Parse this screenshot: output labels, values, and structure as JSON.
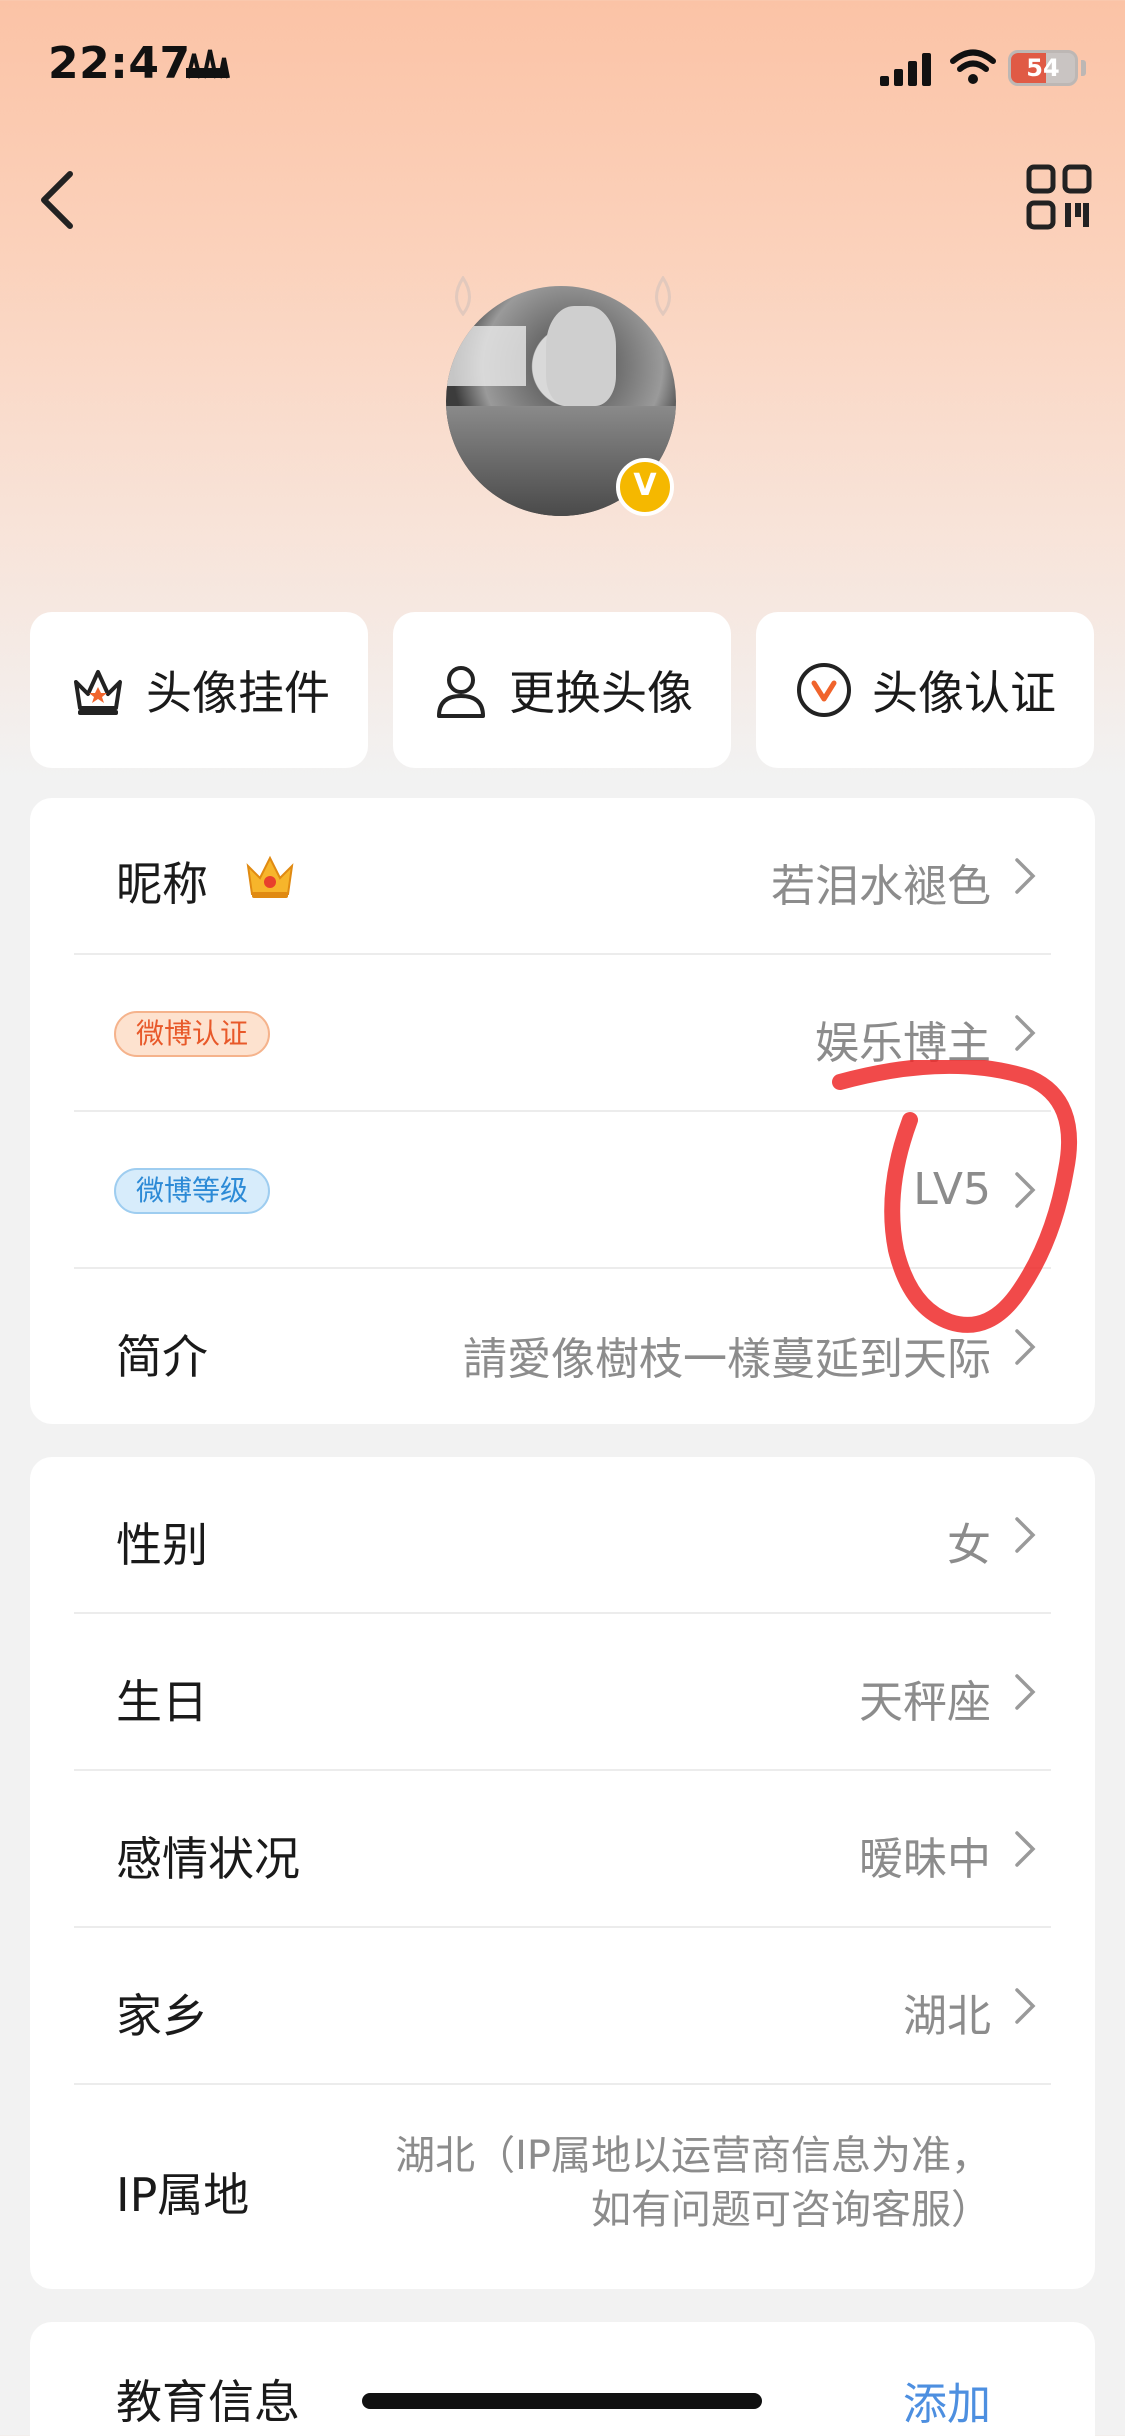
{
  "status_bar": {
    "time": "22:47",
    "battery": "54",
    "battery_fraction": 0.54
  },
  "actions": [
    {
      "label": "头像挂件",
      "icon": "pendant-icon"
    },
    {
      "label": "更换头像",
      "icon": "user-icon"
    },
    {
      "label": "头像认证",
      "icon": "verify-icon"
    }
  ],
  "profile": {
    "nickname_label": "昵称",
    "nickname_value": "若泪水褪色",
    "verify_tag": "微博认证",
    "verify_value": "娱乐博主",
    "level_tag": "微博等级",
    "level_value": "LV5",
    "bio_label": "简介",
    "bio_value": "請愛像樹枝一樣蔓延到天际"
  },
  "details": {
    "gender_label": "性别",
    "gender_value": "女",
    "birthday_label": "生日",
    "birthday_value": "天秤座",
    "relationship_label": "感情状况",
    "relationship_value": "暧昧中",
    "hometown_label": "家乡",
    "hometown_value": "湖北",
    "ip_label": "IP属地",
    "ip_value_line1": "湖北（IP属地以运营商信息为准，",
    "ip_value_line2": "如有问题可咨询客服）"
  },
  "education": {
    "label": "教育信息",
    "action": "添加"
  },
  "colors": {
    "accent_link": "#4d8fe0",
    "badge_gold": "#f5b800",
    "tag_orange": "#e8592a",
    "tag_blue": "#2c8ad6"
  }
}
